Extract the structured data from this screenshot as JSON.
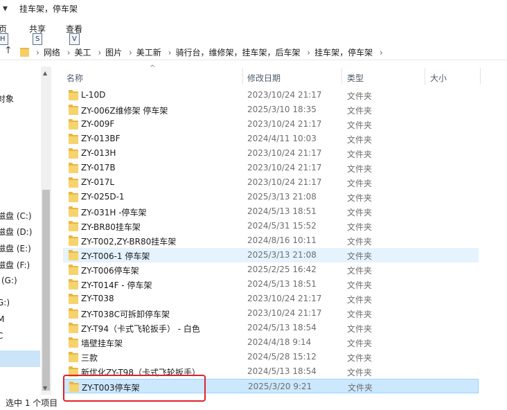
{
  "window": {
    "title": "挂车架，停车架"
  },
  "ribbon": {
    "tabs": [
      {
        "label": "页",
        "keytip": "H"
      },
      {
        "label": "共享",
        "keytip": "S"
      },
      {
        "label": "查看",
        "keytip": "V"
      }
    ]
  },
  "address": {
    "crumbs": [
      "网络",
      "美工",
      "图片",
      "美工新",
      "骑行台，维修架，挂车架，后车架",
      "挂车架，停车架"
    ]
  },
  "nav": {
    "items": [
      "对象",
      "磁盘 (C:)",
      "磁盘 (D:)",
      "磁盘 (E:)",
      "磁盘 (F:)",
      "(G:)",
      "G:)",
      "M",
      "C"
    ]
  },
  "columns": {
    "name": "名称",
    "date": "修改日期",
    "type": "类型",
    "size": "大小"
  },
  "files": [
    {
      "name": "L-10D",
      "date": "2023/10/24 21:17",
      "type": "文件夹"
    },
    {
      "name": "ZY-006Z维修架 停车架",
      "date": "2025/3/10 18:35",
      "type": "文件夹"
    },
    {
      "name": "ZY-009F",
      "date": "2023/10/24 21:17",
      "type": "文件夹"
    },
    {
      "name": "ZY-013BF",
      "date": "2024/4/11 10:03",
      "type": "文件夹"
    },
    {
      "name": "ZY-013H",
      "date": "2023/10/24 21:17",
      "type": "文件夹"
    },
    {
      "name": "ZY-017B",
      "date": "2023/10/24 21:17",
      "type": "文件夹"
    },
    {
      "name": "ZY-017L",
      "date": "2023/10/24 21:17",
      "type": "文件夹"
    },
    {
      "name": "ZY-025D-1",
      "date": "2025/3/13 21:08",
      "type": "文件夹"
    },
    {
      "name": "ZY-031H -停车架",
      "date": "2024/5/13 18:51",
      "type": "文件夹"
    },
    {
      "name": "ZY-BR80挂车架",
      "date": "2024/5/31 15:52",
      "type": "文件夹"
    },
    {
      "name": "ZY-T002,ZY-BR80挂车架",
      "date": "2024/8/16 10:11",
      "type": "文件夹"
    },
    {
      "name": "ZY-T006-1 停车架",
      "date": "2025/3/13 21:08",
      "type": "文件夹",
      "state": "hover"
    },
    {
      "name": "ZY-T006停车架",
      "date": "2025/2/25 16:42",
      "type": "文件夹"
    },
    {
      "name": "ZY-T014F - 停车架",
      "date": "2024/5/13 18:51",
      "type": "文件夹"
    },
    {
      "name": "ZY-T038",
      "date": "2023/10/24 21:17",
      "type": "文件夹"
    },
    {
      "name": "ZY-T038C可拆卸停车架",
      "date": "2023/10/24 21:17",
      "type": "文件夹"
    },
    {
      "name": "ZY-T94（卡式飞轮扳手） - 白色",
      "date": "2024/5/13 18:54",
      "type": "文件夹"
    },
    {
      "name": "墙壁挂车架",
      "date": "2024/4/18 9:14",
      "type": "文件夹"
    },
    {
      "name": "三款",
      "date": "2024/5/28 15:12",
      "type": "文件夹"
    },
    {
      "name": "新优化ZY-T98（卡式飞轮扳手）",
      "date": "2024/5/13 18:54",
      "type": "文件夹"
    },
    {
      "name": "ZY-T003停车架",
      "date": "2025/3/20 9:21",
      "type": "文件夹",
      "state": "selected"
    }
  ],
  "status": {
    "text": "选中 1 个项目"
  },
  "colors": {
    "selection": "#cce8ff",
    "hover": "#e5f3ff",
    "highlight_box": "#e0202a",
    "folder": "#f6d36d"
  }
}
